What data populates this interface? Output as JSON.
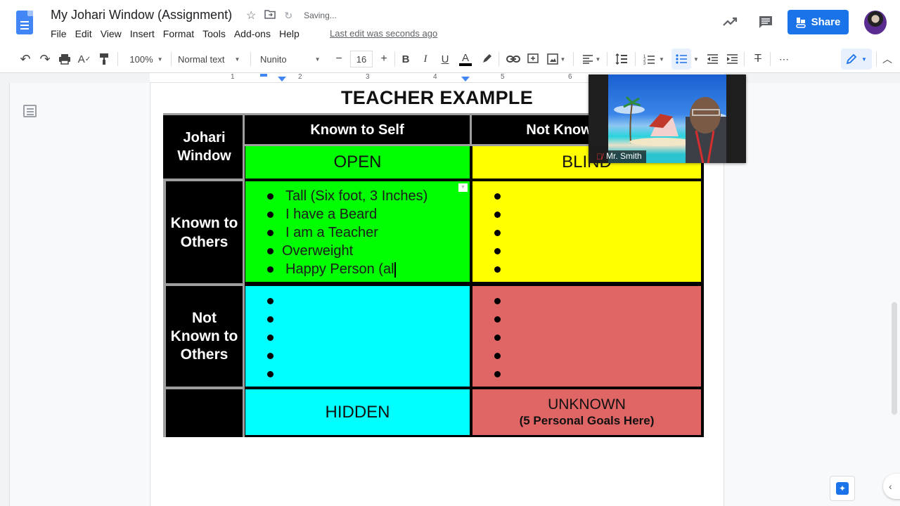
{
  "doc": {
    "title": "My Johari Window (Assignment)",
    "saving_status": "Saving...",
    "last_edit": "Last edit was seconds ago",
    "share_label": "Share"
  },
  "menu": [
    "File",
    "Edit",
    "View",
    "Insert",
    "Format",
    "Tools",
    "Add-ons",
    "Help"
  ],
  "toolbar": {
    "zoom": "100%",
    "style": "Normal text",
    "font": "Nunito",
    "font_size": "16",
    "minus": "−",
    "plus": "+",
    "more": "⋯"
  },
  "ruler": [
    "1",
    "2",
    "3",
    "4",
    "5",
    "6"
  ],
  "content": {
    "heading": "TEACHER EXAMPLE",
    "table": {
      "corner": "Johari Window",
      "col_headers": [
        "Known to Self",
        "Not Known to Self"
      ],
      "row_headers": [
        "Known to Others",
        "Not Known to Others"
      ],
      "quadrant_labels": {
        "open": "OPEN",
        "blind": "BLIND",
        "hidden": "HIDDEN",
        "unknown": "UNKNOWN",
        "unknown_sub": "(5 Personal Goals Here)"
      },
      "open_items": [
        "Tall (Six foot, 3 Inches)",
        "I have a Beard",
        "I am a Teacher",
        "Overweight",
        "Happy Person (al"
      ],
      "blind_items": [
        "",
        "",
        "",
        "",
        ""
      ],
      "hidden_items": [
        "",
        "",
        "",
        "",
        ""
      ],
      "unknown_items": [
        "",
        "",
        "",
        "",
        ""
      ]
    },
    "colors": {
      "open": "#00ff00",
      "blind": "#ffff00",
      "hidden": "#00ffff",
      "unknown": "#e06666",
      "header": "#000000",
      "accent": "#1a73e8"
    }
  },
  "video": {
    "participant_name": "Mr. Smith",
    "muted": true
  }
}
